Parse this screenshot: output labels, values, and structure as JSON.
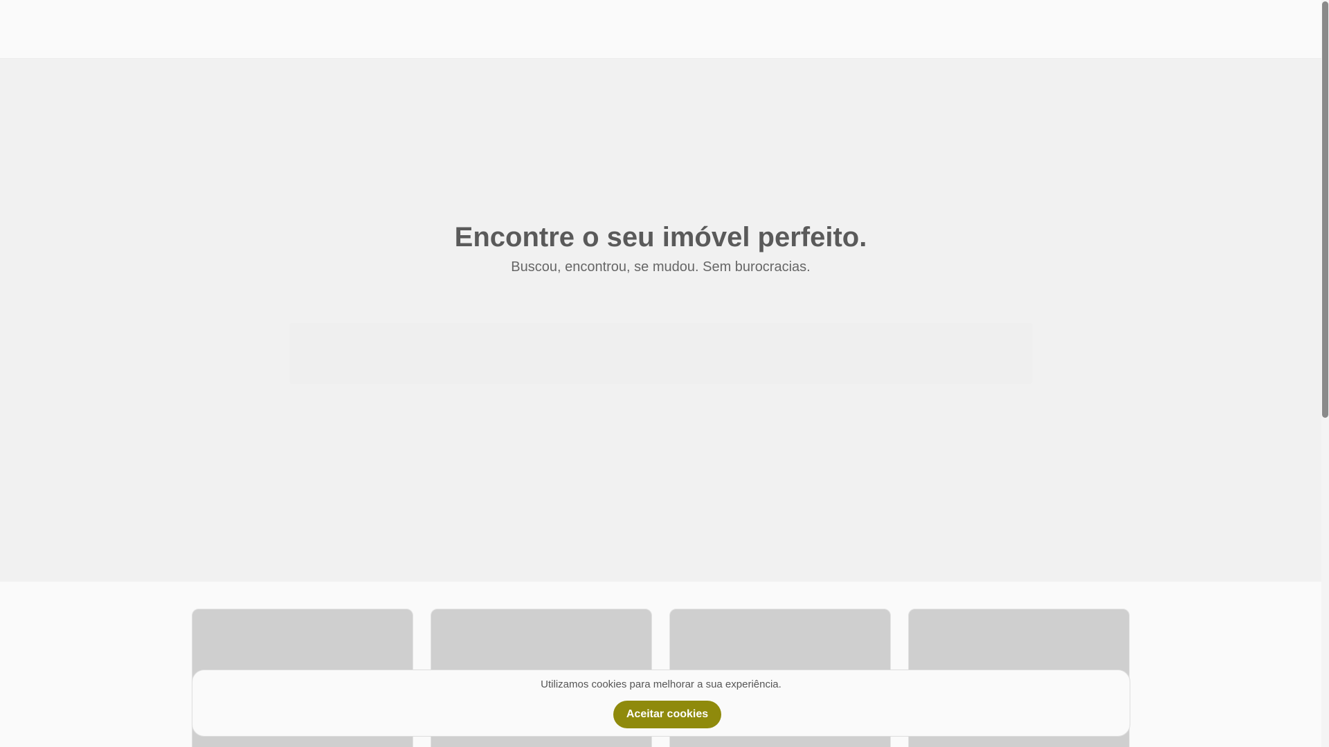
{
  "hero": {
    "title": "Encontre o seu imóvel perfeito.",
    "subtitle": "Buscou, encontrou, se mudou. Sem burocracias."
  },
  "cookie": {
    "message": "Utilizamos cookies para melhorar a sua experiência.",
    "accept_label": "Aceitar cookies"
  },
  "colors": {
    "accent": "#8f8a0c",
    "hero_background": "#f1f1f1",
    "card_placeholder": "#cfcfcf"
  }
}
